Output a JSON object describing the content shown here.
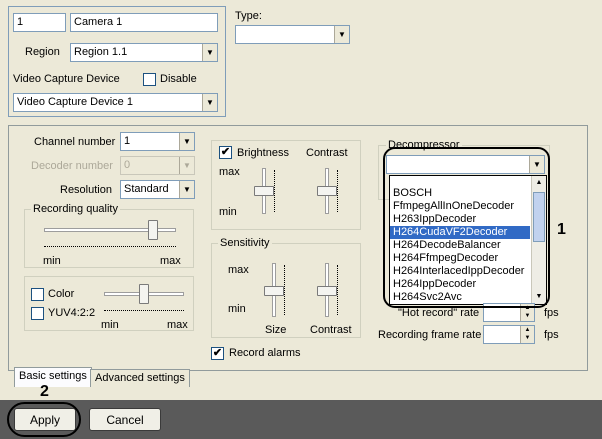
{
  "camera": {
    "id": "1",
    "name": "Camera 1",
    "region_label": "Region",
    "region_value": "Region 1.1",
    "video_capture_label": "Video Capture Device",
    "disable_label": "Disable",
    "video_capture_value": "Video Capture Device 1"
  },
  "type": {
    "label": "Type:",
    "value": ""
  },
  "channel": {
    "channel_number_label": "Channel number",
    "channel_number_value": "1",
    "decoder_number_label": "Decoder number",
    "decoder_number_value": "0",
    "resolution_label": "Resolution",
    "resolution_value": "Standard"
  },
  "recording_quality": {
    "title": "Recording quality",
    "min": "min",
    "max": "max",
    "level": 0.85
  },
  "color": {
    "color_label": "Color",
    "yuv_label": "YUV4:2:2",
    "min": "min",
    "max": "max",
    "level": 0.5
  },
  "brightness": {
    "brightness_label": "Brightness",
    "contrast_label": "Contrast",
    "max": "max",
    "min": "min",
    "brightness_checked": "✔"
  },
  "sensitivity": {
    "title": "Sensitivity",
    "max": "max",
    "min": "min",
    "size_label": "Size",
    "contrast_label": "Contrast"
  },
  "record_alarms": {
    "label": "Record alarms",
    "checked": "✔"
  },
  "decompressor": {
    "title": "Decompressor",
    "value": "",
    "options": [
      "BOSCH",
      "FfmpegAllInOneDecoder",
      "H263IppDecoder",
      "H264CudaVF2Decoder",
      "H264DecodeBalancer",
      "H264FfmpegDecoder",
      "H264InterlacedIppDecoder",
      "H264IppDecoder",
      "H264Svc2Avc"
    ],
    "selected_index": 3
  },
  "frame_rates": {
    "hot_record_label": "\"Hot record\" rate",
    "hot_record_unit": "fps",
    "recording_label": "Recording frame rate",
    "recording_unit": "fps"
  },
  "tabs": {
    "basic": "Basic settings",
    "advanced": "Advanced settings"
  },
  "buttons": {
    "apply": "Apply",
    "cancel": "Cancel"
  },
  "callouts": {
    "one": "1",
    "two": "2"
  }
}
